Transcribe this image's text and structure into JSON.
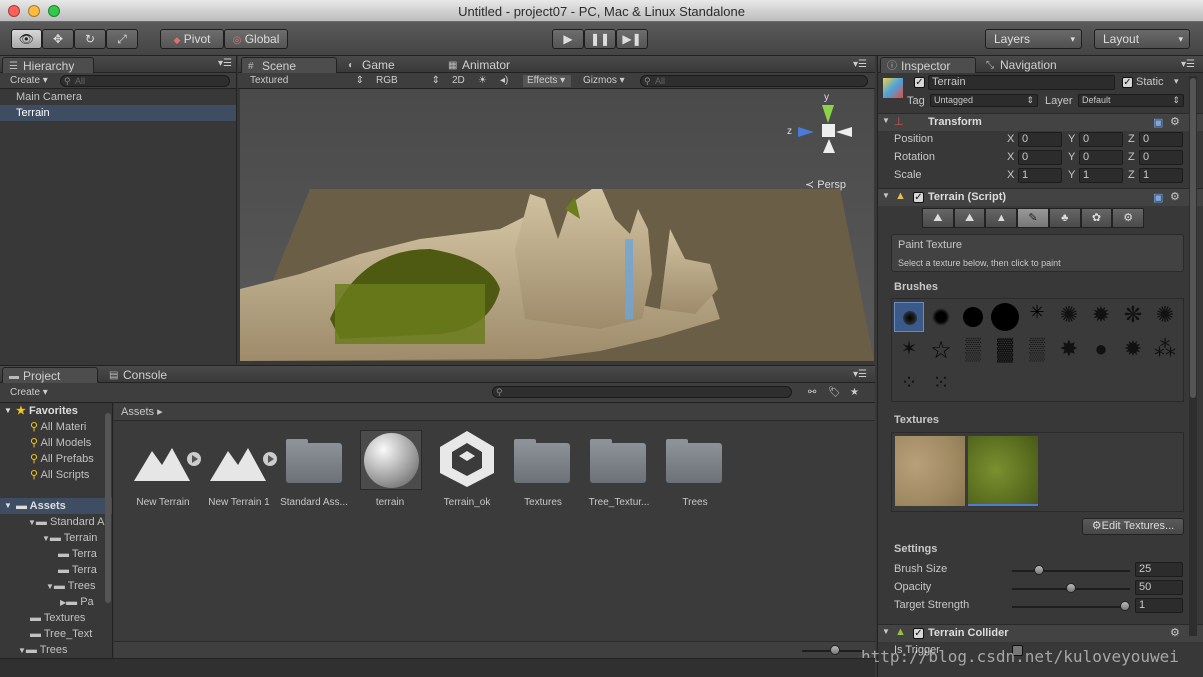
{
  "window": {
    "title": "Untitled - project07 - PC, Mac & Linux Standalone"
  },
  "toolbar": {
    "pivot": "Pivot",
    "global": "Global",
    "layers": "Layers",
    "layout": "Layout"
  },
  "hierarchy": {
    "tab": "Hierarchy",
    "create": "Create",
    "search_placeholder": "All",
    "items": [
      "Main Camera",
      "Terrain"
    ]
  },
  "scene": {
    "tabs": {
      "scene": "Scene",
      "game": "Game",
      "animator": "Animator"
    },
    "shading": "Textured",
    "render": "RGB",
    "mode2d": "2D",
    "effects": "Effects",
    "gizmos": "Gizmos",
    "search_placeholder": "All",
    "persp": "Persp",
    "axis_y": "y",
    "axis_z": "z"
  },
  "project": {
    "tab": "Project",
    "console": "Console",
    "create": "Create",
    "breadcrumb": "Assets",
    "favorites": {
      "label": "Favorites",
      "items": [
        "All Materi",
        "All Models",
        "All Prefabs",
        "All Scripts"
      ]
    },
    "tree": [
      "Assets",
      "Standard A",
      "Terrain",
      "Terra",
      "Terra",
      "Trees",
      "Pa",
      "Textures",
      "Tree_Text",
      "Trees"
    ],
    "assets": [
      "New Terrain",
      "New Terrain 1",
      "Standard Ass...",
      "terrain",
      "Terrain_ok",
      "Textures",
      "Tree_Textur...",
      "Trees"
    ]
  },
  "inspector": {
    "tab": "Inspector",
    "nav": "Navigation",
    "object_name": "Terrain",
    "static": "Static",
    "tag_label": "Tag",
    "tag": "Untagged",
    "layer_label": "Layer",
    "layer": "Default",
    "transform": {
      "title": "Transform",
      "rows": [
        {
          "label": "Position",
          "x": "0",
          "y": "0",
          "z": "0"
        },
        {
          "label": "Rotation",
          "x": "0",
          "y": "0",
          "z": "0"
        },
        {
          "label": "Scale",
          "x": "1",
          "y": "1",
          "z": "1"
        }
      ],
      "x": "X",
      "y": "Y",
      "z": "Z"
    },
    "terrain_script": {
      "title": "Terrain (Script)",
      "paint_title": "Paint Texture",
      "paint_desc": "Select a texture below, then click to paint",
      "brushes": "Brushes",
      "textures": "Textures",
      "edit_textures": "Edit Textures...",
      "settings": "Settings",
      "brush_size_label": "Brush Size",
      "brush_size": "25",
      "opacity_label": "Opacity",
      "opacity": "50",
      "strength_label": "Target Strength",
      "strength": "1",
      "brush_size_level": 0.2,
      "opacity_level": 0.5,
      "strength_level": 1.0
    },
    "collider": {
      "title": "Terrain Collider",
      "is_trigger": "Is Trigger"
    }
  },
  "watermark": "http://blog.csdn.net/kuloveyouwei"
}
